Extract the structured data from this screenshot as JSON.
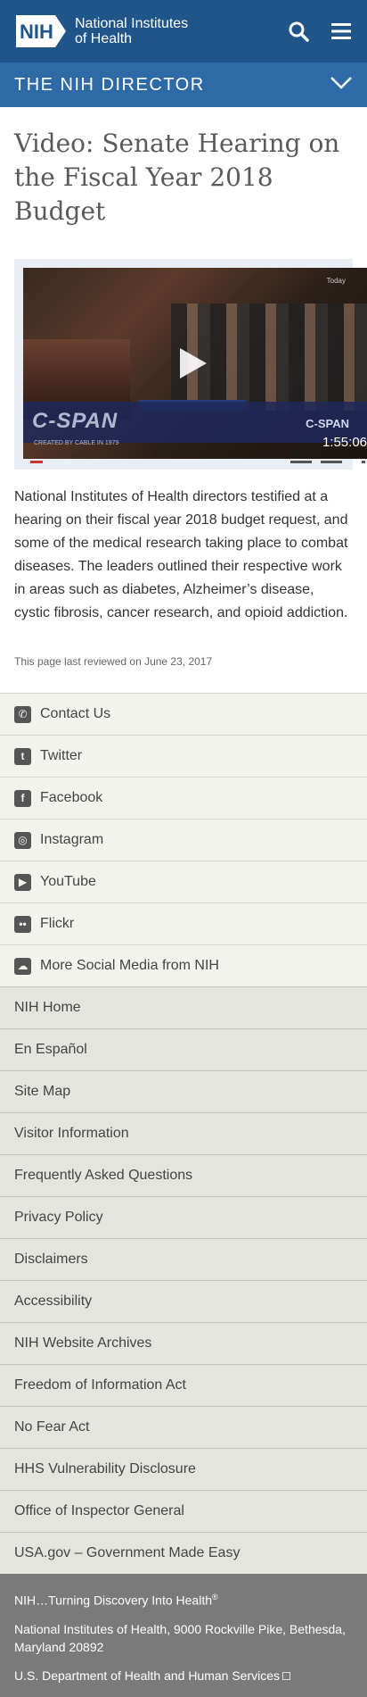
{
  "header": {
    "logo_mark": "NIH",
    "logo_line1": "National Institutes",
    "logo_line2": "of Health",
    "brand_color": "#20558a",
    "search_icon": "search-icon",
    "menu_icon": "hamburger-menu-icon"
  },
  "section": {
    "title": "THE NIH DIRECTOR",
    "bar_color": "#2d6aa6"
  },
  "article": {
    "title": "Video: Senate Hearing on the Fiscal Year 2018 Budget",
    "video": {
      "duration": "1:55:06",
      "today_label": "Today",
      "cspan_logo": "C-SPAN",
      "cspan_sub": "CREATED BY CABLE IN 1979",
      "cspan_corner": "C-SPAN"
    },
    "body": "National Institutes of Health directors testified at a hearing on their fiscal year 2018 budget request, and some of the medical research taking place to combat diseases. The leaders outlined their respective work in areas such as diabetes, Alzheimer’s disease, cystic fibrosis, cancer research, and opioid addiction.",
    "reviewed": "This page last reviewed on June 23, 2017"
  },
  "social": [
    {
      "label": "Contact Us",
      "icon": "phone-icon",
      "glyph": "✆"
    },
    {
      "label": "Twitter",
      "icon": "twitter-icon",
      "glyph": "t"
    },
    {
      "label": "Facebook",
      "icon": "facebook-icon",
      "glyph": "f"
    },
    {
      "label": "Instagram",
      "icon": "instagram-icon",
      "glyph": "◎"
    },
    {
      "label": "YouTube",
      "icon": "youtube-icon",
      "glyph": "▶"
    },
    {
      "label": "Flickr",
      "icon": "flickr-icon",
      "glyph": "••"
    },
    {
      "label": "More Social Media from NIH",
      "icon": "social-media-icon",
      "glyph": "☁"
    }
  ],
  "nav": [
    {
      "label": "NIH Home"
    },
    {
      "label": "En Español"
    },
    {
      "label": "Site Map"
    },
    {
      "label": "Visitor Information"
    },
    {
      "label": "Frequently Asked Questions"
    },
    {
      "label": "Privacy Policy"
    },
    {
      "label": "Disclaimers"
    },
    {
      "label": "Accessibility"
    },
    {
      "label": "NIH Website Archives"
    },
    {
      "label": "Freedom of Information Act"
    },
    {
      "label": "No Fear Act"
    },
    {
      "label": "HHS Vulnerability Disclosure"
    },
    {
      "label": "Office of Inspector General"
    },
    {
      "label": "USA.gov – Government Made Easy"
    }
  ],
  "footer": {
    "tagline": "NIH…Turning Discovery Into Health",
    "tagline_mark": "®",
    "address": "National Institutes of Health, 9000 Rockville Pike, Bethesda, Maryland 20892",
    "hhs_link": "U.S. Department of Health and Human Services"
  }
}
